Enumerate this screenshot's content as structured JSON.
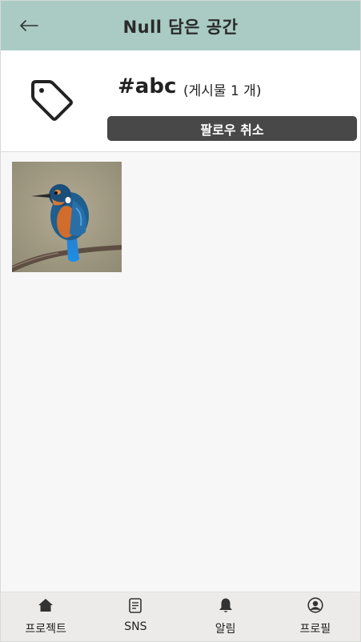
{
  "header": {
    "back_icon": "arrow-left-icon",
    "title": "Null 담은 공간"
  },
  "tag": {
    "icon": "tag-icon",
    "name": "#abc",
    "post_count": "(게시물 1 개)",
    "unfollow_label": "팔로우 취소"
  },
  "posts": [
    {
      "image": "kingfisher-bird-on-branch"
    }
  ],
  "nav": {
    "items": [
      {
        "label": "프로젝트",
        "icon": "home-icon"
      },
      {
        "label": "SNS",
        "icon": "document-icon"
      },
      {
        "label": "알림",
        "icon": "bell-icon"
      },
      {
        "label": "프로필",
        "icon": "user-circle-icon"
      }
    ]
  },
  "colors": {
    "header_bg": "#a9cbc3",
    "button_bg": "#484848",
    "page_bg": "#f7f7f7",
    "nav_bg": "#ecebe9"
  }
}
